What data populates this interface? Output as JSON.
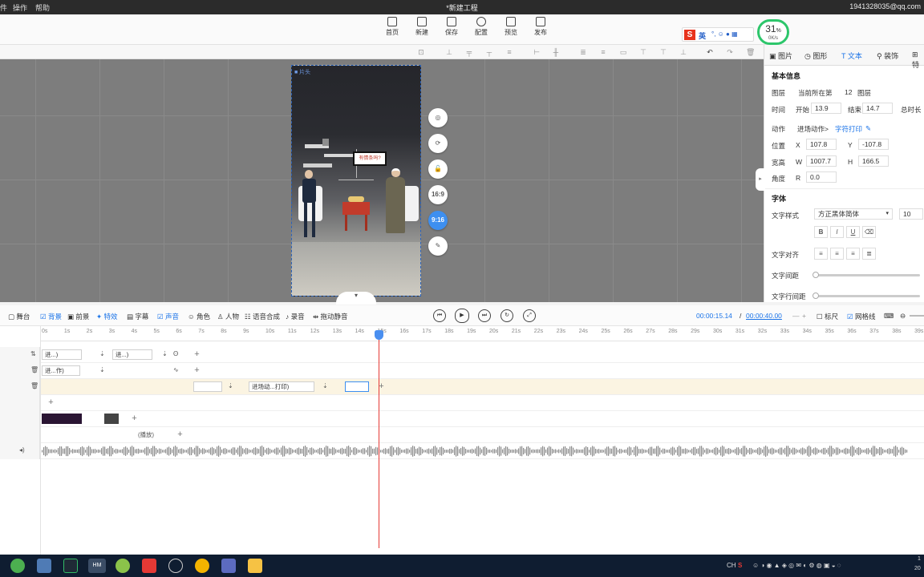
{
  "titlebar": {
    "menus": [
      "件",
      "操作",
      "帮助"
    ],
    "title": "*新建工程",
    "account": "1941328035@qq.com"
  },
  "toolbar": {
    "buttons": [
      {
        "label": "首页",
        "icon": "home-icon"
      },
      {
        "label": "新建",
        "icon": "new-file-icon"
      },
      {
        "label": "保存",
        "icon": "save-icon"
      },
      {
        "label": "配置",
        "icon": "settings-icon"
      },
      {
        "label": "预览",
        "icon": "preview-icon"
      },
      {
        "label": "发布",
        "icon": "publish-icon"
      }
    ]
  },
  "ime": {
    "logo": "S",
    "mode": "英"
  },
  "perf": {
    "percent": "31",
    "unit": "%",
    "rate": "0K/s",
    "color": "#2dc66b"
  },
  "canvas": {
    "phone_header": "■ 片头",
    "speech_bubble": "有情条吗?",
    "side_buttons": [
      {
        "name": "snapshot-button",
        "glyph": "◎"
      },
      {
        "name": "refresh-button",
        "glyph": "⟳"
      },
      {
        "name": "unlock-button",
        "glyph": "🔓"
      },
      {
        "name": "ratio-16-9-button",
        "glyph": "16:9"
      },
      {
        "name": "ratio-9-16-button",
        "glyph": "9:16"
      },
      {
        "name": "edit-button",
        "glyph": "✎"
      }
    ],
    "active_ratio": "9:16"
  },
  "panel": {
    "tabs": [
      "图片",
      "图形",
      "文本",
      "装饰",
      "特"
    ],
    "active_tab": "文本",
    "basic_info": "基本信息",
    "layer_label": "图层",
    "layer_value": "当前所在第",
    "layer_num": "12",
    "layer_suffix": "图层",
    "time_label": "时间",
    "start_label": "开始",
    "start_value": "13.9",
    "end_label": "结束",
    "end_value": "14.7",
    "total_label": "总时长",
    "action_label": "动作",
    "action_value": "进场动作>",
    "action_effect": "字符打印",
    "position_label": "位置",
    "x_label": "X",
    "x_value": "107.8",
    "y_label": "Y",
    "y_value": "-107.8",
    "size_label": "宽高",
    "w_label": "W",
    "w_value": "1007.7",
    "h_label": "H",
    "h_value": "166.5",
    "angle_label": "角度",
    "r_label": "R",
    "r_value": "0.0",
    "font_section": "字体",
    "font_style_label": "文字样式",
    "font_family_value": "方正黑体简体",
    "font_size_value": "10",
    "format_buttons": [
      "B",
      "I",
      "U",
      "⌫"
    ],
    "align_label": "文字对齐",
    "spacing_label": "文字间距",
    "line_spacing_label": "文字行间距"
  },
  "timeline": {
    "tools": [
      {
        "label": "舞台",
        "active": false
      },
      {
        "label": "背景",
        "active": true
      },
      {
        "label": "前景",
        "active": false
      },
      {
        "label": "特效",
        "active": true
      },
      {
        "label": "字幕",
        "active": false
      },
      {
        "label": "声音",
        "active": true
      },
      {
        "label": "角色",
        "active": false
      },
      {
        "label": "人物",
        "active": false
      },
      {
        "label": "语音合成",
        "active": false
      },
      {
        "label": "录音",
        "active": false
      },
      {
        "label": "拖动静音",
        "active": false
      }
    ],
    "current_time": "00:00:15.14",
    "separator": "/",
    "total_time": "00:00:40.00",
    "ruler_label": "标尺",
    "grid_label": "网格线",
    "ruler_ticks": [
      "0s",
      "1s",
      "2s",
      "3s",
      "4s",
      "5s",
      "6s",
      "7s",
      "8s",
      "9s",
      "10s",
      "11s",
      "12s",
      "13s",
      "14s",
      "15s",
      "16s",
      "17s",
      "18s",
      "19s",
      "20s",
      "21s",
      "22s",
      "23s",
      "24s",
      "25s",
      "26s",
      "27s",
      "28s",
      "29s",
      "30s",
      "31s",
      "32s",
      "33s",
      "34s",
      "35s",
      "36s",
      "37s",
      "38s",
      "39s"
    ],
    "track1_clips": [
      "进...)",
      "进...)"
    ],
    "track2_clip": "进...作)",
    "track3_clip": "进场动...打印)",
    "track6_clip": "(播放)"
  },
  "taskbar": {
    "ime_tray": "CH",
    "time": "1",
    "date": "20"
  }
}
